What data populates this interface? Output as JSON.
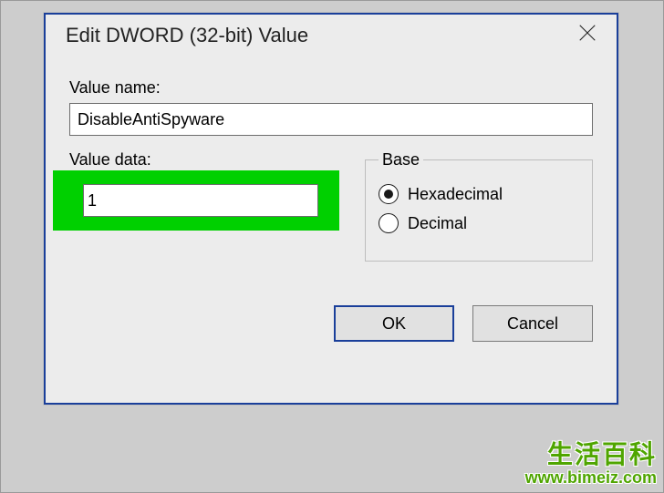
{
  "dialog": {
    "title": "Edit DWORD (32-bit) Value",
    "value_name_label": "Value name:",
    "value_name": "DisableAntiSpyware",
    "value_data_label": "Value data:",
    "value_data": "1",
    "base": {
      "legend": "Base",
      "hex_label": "Hexadecimal",
      "dec_label": "Decimal",
      "selected": "hex"
    },
    "buttons": {
      "ok": "OK",
      "cancel": "Cancel"
    }
  },
  "watermark": {
    "text_cn": "生活百科",
    "url": "www.bimeiz.com"
  }
}
